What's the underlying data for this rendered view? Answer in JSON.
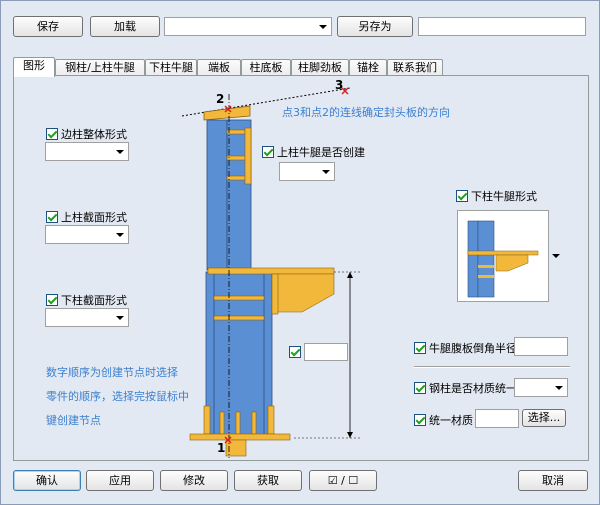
{
  "toolbar": {
    "save_label": "保存",
    "load_label": "加载",
    "preset_value": "",
    "save_as_label": "另存为",
    "save_as_name": ""
  },
  "tabs": [
    {
      "label": "图形",
      "active": true
    },
    {
      "label": "钢柱/上柱牛腿",
      "active": false
    },
    {
      "label": "下柱牛腿",
      "active": false
    },
    {
      "label": "端板",
      "active": false
    },
    {
      "label": "柱底板",
      "active": false
    },
    {
      "label": "柱脚劲板",
      "active": false
    },
    {
      "label": "锚栓",
      "active": false
    },
    {
      "label": "联系我们",
      "active": false
    }
  ],
  "options": {
    "edge_column_form": {
      "label": "边柱整体形式",
      "checked": true,
      "value": ""
    },
    "upper_section_form": {
      "label": "上柱截面形式",
      "checked": true,
      "value": ""
    },
    "lower_section_form": {
      "label": "下柱截面形式",
      "checked": true,
      "value": ""
    },
    "upper_bracket_create": {
      "label": "上柱牛腿是否创建",
      "checked": true,
      "value": ""
    },
    "lower_bracket_form": {
      "label": "下柱牛腿形式",
      "checked": true
    },
    "middle_field": {
      "checked": true,
      "value": ""
    },
    "bracket_web_chamfer": {
      "label": "牛腿腹板倒角半径",
      "checked": true,
      "value": ""
    },
    "column_same_material": {
      "label": "钢柱是否材质统一",
      "checked": true,
      "value": ""
    },
    "unify_material": {
      "label": "统一材质",
      "checked": true,
      "value": "",
      "select_label": "选择..."
    }
  },
  "diagram": {
    "point1": "1",
    "point2": "2",
    "point3": "3",
    "note_direction": "点3和点2的连线确定封头板的方向"
  },
  "notes": {
    "line1": "数字顺序为创建节点时选择",
    "line2": "零件的顺序，选择完按鼠标中",
    "line3": "键创建节点"
  },
  "footer": {
    "ok_label": "确认",
    "apply_label": "应用",
    "modify_label": "修改",
    "get_label": "获取",
    "toggle_on": "☑",
    "toggle_sep": "/",
    "toggle_off": "☐",
    "cancel_label": "取消"
  },
  "colors": {
    "steel_blue": "#5b8fd4",
    "plate_orange": "#f2b83c",
    "note_blue": "#3a7fd0"
  }
}
